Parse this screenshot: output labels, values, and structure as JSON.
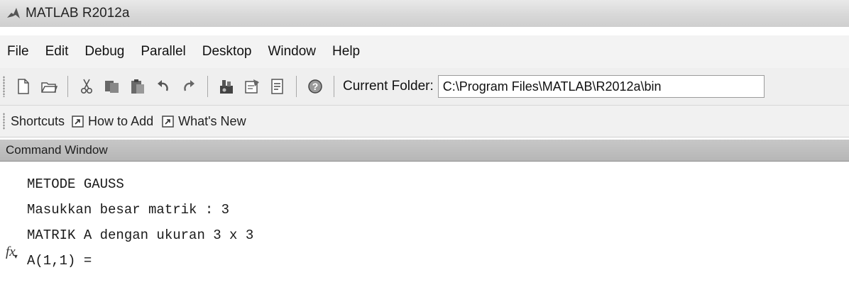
{
  "window": {
    "title": "MATLAB  R2012a"
  },
  "menu": {
    "items": [
      "File",
      "Edit",
      "Debug",
      "Parallel",
      "Desktop",
      "Window",
      "Help"
    ]
  },
  "toolbar": {
    "icons": [
      "new-file-icon",
      "open-folder-icon",
      "cut-icon",
      "copy-icon",
      "paste-icon",
      "undo-icon",
      "redo-icon",
      "simulink-icon",
      "guide-icon",
      "profiler-icon",
      "help-icon"
    ],
    "current_folder_label": "Current Folder:",
    "current_folder_value": "C:\\Program Files\\MATLAB\\R2012a\\bin"
  },
  "shortcuts": {
    "label": "Shortcuts",
    "items": [
      "How to Add",
      "What's New"
    ]
  },
  "command_window": {
    "title": "Command Window",
    "lines": [
      "METODE GAUSS",
      "Masukkan besar matrik : 3",
      "MATRIK A dengan ukuran 3 x 3",
      "A(1,1) ="
    ],
    "prompt_icon": "fx"
  },
  "colors": {
    "title_bar": "#d8d8d8",
    "menu_bar": "#f3f3f3",
    "header_bar": "#bdbdbd",
    "background": "#ffffff"
  }
}
